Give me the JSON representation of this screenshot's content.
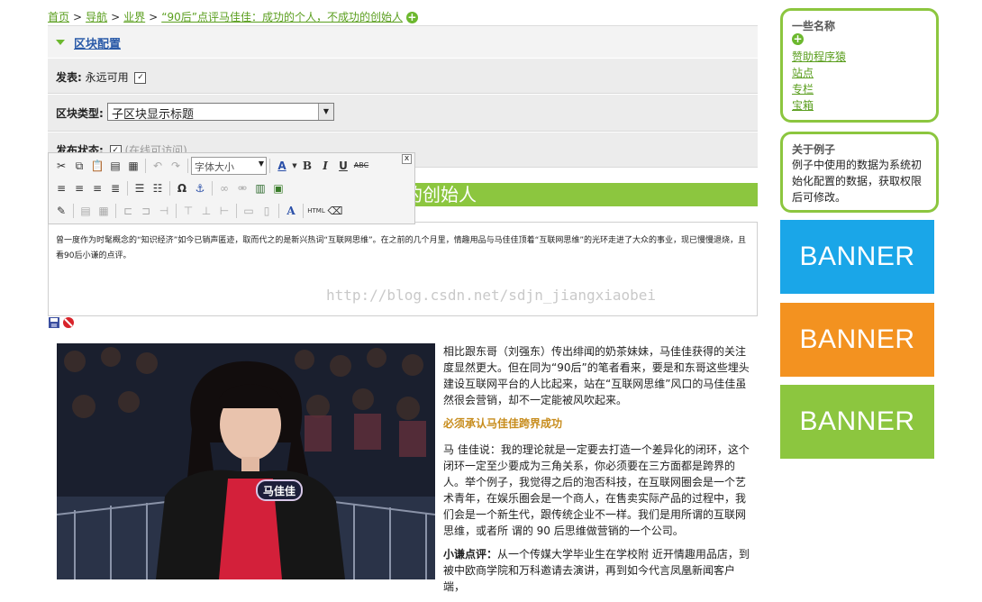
{
  "breadcrumb": {
    "items": [
      "首页",
      "导航",
      "业界",
      "“90后”点评马佳佳：成功的个人，不成功的创始人"
    ],
    "sep": ">"
  },
  "config": {
    "title": "区块配置",
    "publish_label": "发表:",
    "publish_value": "永远可用",
    "type_label": "区块类型:",
    "type_value": "子区块显示标题",
    "status_label": "发布状态:",
    "status_value": "(在线可访问)"
  },
  "toolbar": {
    "font_size_placeholder": "字体大小",
    "close": "x"
  },
  "content": {
    "title_fragment": "功的创始人",
    "editor_text": "曾一度作为时髦概念的“知识经济”如今已销声匿迹，取而代之的是新兴热词“互联网思维”。在之前的几个月里，情趣用品与马佳佳顶着“互联网思维”的光环走进了大众的事业，现已慢慢退烧，且看90后小谦的点评。",
    "watermark": "http://blog.csdn.net/sdjn_jiangxiaobei"
  },
  "article": {
    "p1": "相比跟东哥（刘强东）传出绯闻的奶茶妹妹，马佳佳获得的关注度显然更大。但在同为“90后”的笔者看来，要是和东哥这些埋头建设互联网平台的人比起来，站在“互联网思维”风口的马佳佳虽然很会营销，却不一定能被风吹起来。",
    "subtitle": "必须承认马佳佳跨界成功",
    "p2": "马 佳佳说：我的理论就是一定要去打造一个差异化的闭环，这个闭环一定至少要成为三角关系，你必须要在三方面都是跨界的人。举个例子，我觉得之后的泡否科技，在互联网圈会是一个艺术青年，在娱乐圈会是一个商人，在售卖实际产品的过程中，我们会是一个新生代，跟传统企业不一样。我们是用所谓的互联网思维，或者所 谓的 90 后思维做营销的一个公司。",
    "p3_bold": "小谦点评：",
    "p3": "从一个传媒大学毕业生在学校附 近开情趣用品店，到被中欧商学院和万科邀请去演讲，再到如今代言凤凰新闻客户端，"
  },
  "photo": {
    "badge": "马佳佳"
  },
  "sidebar": {
    "box1": {
      "title": "一些名称",
      "links": [
        "赞助程序猿",
        "站点",
        "专栏",
        "宝箱"
      ]
    },
    "box2": {
      "title": "关于例子",
      "body": "例子中使用的数据为系统初始化配置的数据，获取权限后可修改。"
    },
    "banners": [
      {
        "label": "BANNER",
        "color": "#1aa6e8"
      },
      {
        "label": "BANNER",
        "color": "#f39220"
      },
      {
        "label": "BANNER",
        "color": "#8cc63f"
      }
    ]
  }
}
